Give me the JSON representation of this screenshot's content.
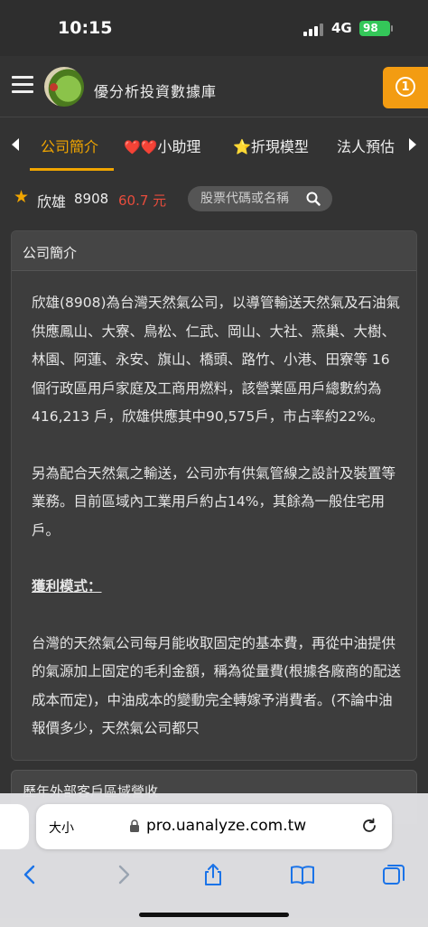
{
  "status_bar": {
    "time": "10:15",
    "network": "4G",
    "battery": "98"
  },
  "header": {
    "site_title": "優分析投資數據庫",
    "notification_badge": "1"
  },
  "tabs": [
    {
      "label": "公司簡介",
      "active": true
    },
    {
      "label": "小助理",
      "prefix": "❤️❤️"
    },
    {
      "label": "折現模型",
      "prefix": "⭐"
    },
    {
      "label": "法人預估"
    }
  ],
  "stock": {
    "name": "欣雄",
    "code": "8908",
    "price": "60.7 元"
  },
  "search": {
    "placeholder": "股票代碼或名稱"
  },
  "profile_card": {
    "title": "公司簡介",
    "para1": "欣雄(8908)為台灣天然氣公司，以導管輸送天然氣及石油氣供應鳳山、大寮、鳥松、仁武、岡山、大社、燕巢、大樹、林園、阿蓮、永安、旗山、橋頭、路竹、小港、田寮等 16 個行政區用戶家庭及工商用燃料，該營業區用戶總數約為 416,213 戶，欣雄供應其中90,575戶，市占率約22%。",
    "para2": "另為配合天然氣之輸送，公司亦有供氣管線之設計及裝置等業務。目前區域內工業用戶約占14%，其餘為一般住宅用戶。",
    "profit_heading": "獲利模式：",
    "para3": "台灣的天然氣公司每月能收取固定的基本費，再從中油提供的氣源加上固定的毛利金額，稱為從量費(根據各廠商的配送成本而定)，中油成本的變動完全轉嫁予消費者。(不論中油報價多少，天然氣公司都只"
  },
  "next_card": {
    "title": "歷年外部客戶區域營收"
  },
  "browser": {
    "font_size_label": "大小",
    "url": "pro.uanalyze.com.tw"
  }
}
